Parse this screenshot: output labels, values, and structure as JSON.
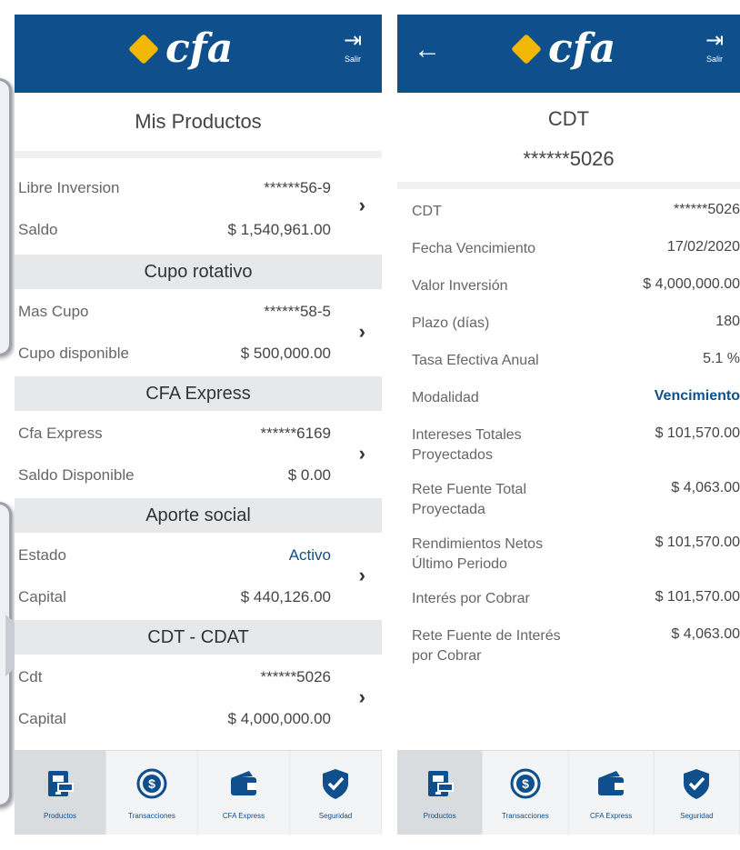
{
  "left_phone": {
    "header": {
      "exit_label": "Salir"
    },
    "title": "Mis Productos",
    "products": [
      {
        "rows": [
          {
            "label": "Libre Inversion",
            "value": "******56-9"
          },
          {
            "label": "Saldo",
            "value": "$ 1,540,961.00"
          }
        ]
      },
      {
        "section": "Cupo rotativo",
        "rows": [
          {
            "label": "Mas Cupo",
            "value": "******58-5"
          },
          {
            "label": "Cupo disponible",
            "value": "$ 500,000.00"
          }
        ]
      },
      {
        "section": "CFA Express",
        "rows": [
          {
            "label": "Cfa Express",
            "value": "******6169"
          },
          {
            "label": "Saldo Disponible",
            "value": "$ 0.00"
          }
        ]
      },
      {
        "section": "Aporte social",
        "rows": [
          {
            "label": "Estado",
            "value": "Activo"
          },
          {
            "label": "Capital",
            "value": "$ 440,126.00"
          }
        ]
      },
      {
        "section": "CDT - CDAT",
        "rows": [
          {
            "label": "Cdt",
            "value": "******5026"
          },
          {
            "label": "Capital",
            "value": "$ 4,000,000.00"
          }
        ]
      }
    ],
    "tabs": [
      "Productos",
      "Transacciones",
      "CFA Express",
      "Seguridad"
    ]
  },
  "right_phone": {
    "header": {
      "exit_label": "Salir"
    },
    "title": "CDT",
    "account": "******5026",
    "details": [
      {
        "label": "CDT",
        "value": "******5026"
      },
      {
        "label": "Fecha Vencimiento",
        "value": "17/02/2020"
      },
      {
        "label": "Valor Inversión",
        "value": "$ 4,000,000.00"
      },
      {
        "label": "Plazo (días)",
        "value": "180"
      },
      {
        "label": "Tasa Efectiva Anual",
        "value": "5.1 %"
      },
      {
        "label": "Modalidad",
        "value": "Vencimiento"
      },
      {
        "label": "Intereses Totales Proyectados",
        "value": "$ 101,570.00"
      },
      {
        "label": "Rete Fuente Total Proyectada",
        "value": "$ 4,063.00"
      },
      {
        "label": "Rendimientos Netos Último Periodo",
        "value": "$ 101,570.00"
      },
      {
        "label": "Interés por Cobrar",
        "value": "$ 101,570.00"
      },
      {
        "label": "Rete Fuente de Interés por Cobrar",
        "value": "$ 4,063.00"
      }
    ],
    "tabs": [
      "Productos",
      "Transacciones",
      "CFA Express",
      "Seguridad"
    ]
  },
  "brand": {
    "logo_text": "cfa",
    "primary_color": "#0e4f8c",
    "accent_color": "#f2b705"
  },
  "icons": {
    "exit": "exit-icon",
    "back": "back-arrow-icon",
    "chevron": "chevron-right-icon"
  }
}
